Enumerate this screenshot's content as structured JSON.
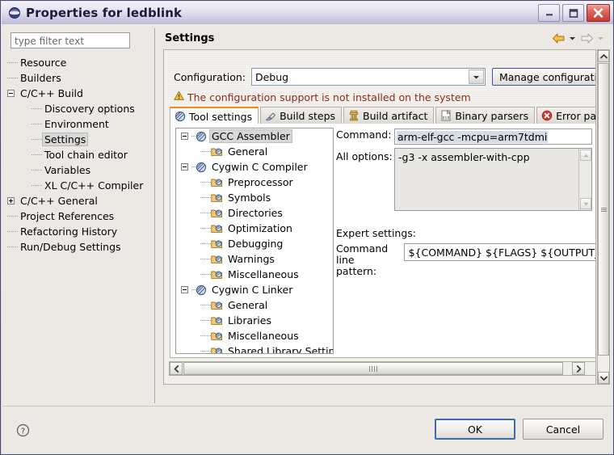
{
  "window": {
    "title": "Properties for ledblink",
    "icon": "eclipse-sphere-icon",
    "minimize_label": "Minimize",
    "maximize_label": "Maximize",
    "close_label": "Close"
  },
  "filter": {
    "placeholder": "type filter text",
    "value": ""
  },
  "nav_tree": [
    {
      "label": "Resource",
      "depth": 1,
      "expander": "none",
      "selected": false
    },
    {
      "label": "Builders",
      "depth": 1,
      "expander": "none",
      "selected": false
    },
    {
      "label": "C/C++ Build",
      "depth": 1,
      "expander": "collapse",
      "selected": false
    },
    {
      "label": "Discovery options",
      "depth": 2,
      "expander": "none",
      "selected": false
    },
    {
      "label": "Environment",
      "depth": 2,
      "expander": "none",
      "selected": false
    },
    {
      "label": "Settings",
      "depth": 2,
      "expander": "none",
      "selected": true
    },
    {
      "label": "Tool chain editor",
      "depth": 2,
      "expander": "none",
      "selected": false
    },
    {
      "label": "Variables",
      "depth": 2,
      "expander": "none",
      "selected": false
    },
    {
      "label": "XL C/C++ Compiler",
      "depth": 2,
      "expander": "none",
      "selected": false
    },
    {
      "label": "C/C++ General",
      "depth": 1,
      "expander": "expand",
      "selected": false
    },
    {
      "label": "Project References",
      "depth": 1,
      "expander": "none",
      "selected": false
    },
    {
      "label": "Refactoring History",
      "depth": 1,
      "expander": "none",
      "selected": false
    },
    {
      "label": "Run/Debug Settings",
      "depth": 1,
      "expander": "none",
      "selected": false
    }
  ],
  "page": {
    "title": "Settings",
    "back_icon": "back-arrow-icon",
    "back_dropdown_icon": "chevron-down-icon",
    "forward_icon": "forward-arrow-icon",
    "forward_dropdown_icon": "chevron-down-icon"
  },
  "configuration": {
    "label": "Configuration:",
    "value": "Debug",
    "dropdown_icon": "chevron-down-icon",
    "manage_button": "Manage configurations..."
  },
  "warning": {
    "icon": "warning-triangle-icon",
    "text": "The configuration support is not installed on the system",
    "color": "#8c2b17"
  },
  "tabs": [
    {
      "label": "Tool settings",
      "icon": "tool-settings-icon",
      "active": true
    },
    {
      "label": "Build steps",
      "icon": "build-steps-icon",
      "active": false
    },
    {
      "label": "Build artifact",
      "icon": "build-artifact-icon",
      "active": false
    },
    {
      "label": "Binary parsers",
      "icon": "binary-parsers-icon",
      "active": false
    },
    {
      "label": "Error parsers",
      "icon": "error-parsers-icon",
      "active": false
    }
  ],
  "tool_tree": [
    {
      "label": "GCC Assembler",
      "depth": 1,
      "expander": "collapse",
      "icon": "tool-icon",
      "selected": true
    },
    {
      "label": "General",
      "depth": 2,
      "expander": "none",
      "icon": "folder-icon",
      "selected": false
    },
    {
      "label": "Cygwin C Compiler",
      "depth": 1,
      "expander": "collapse",
      "icon": "tool-icon",
      "selected": false
    },
    {
      "label": "Preprocessor",
      "depth": 2,
      "expander": "none",
      "icon": "folder-icon",
      "selected": false
    },
    {
      "label": "Symbols",
      "depth": 2,
      "expander": "none",
      "icon": "folder-icon",
      "selected": false
    },
    {
      "label": "Directories",
      "depth": 2,
      "expander": "none",
      "icon": "folder-icon",
      "selected": false
    },
    {
      "label": "Optimization",
      "depth": 2,
      "expander": "none",
      "icon": "folder-icon",
      "selected": false
    },
    {
      "label": "Debugging",
      "depth": 2,
      "expander": "none",
      "icon": "folder-icon",
      "selected": false
    },
    {
      "label": "Warnings",
      "depth": 2,
      "expander": "none",
      "icon": "folder-icon",
      "selected": false
    },
    {
      "label": "Miscellaneous",
      "depth": 2,
      "expander": "none",
      "icon": "folder-icon",
      "selected": false
    },
    {
      "label": "Cygwin C Linker",
      "depth": 1,
      "expander": "collapse",
      "icon": "tool-icon",
      "selected": false
    },
    {
      "label": "General",
      "depth": 2,
      "expander": "none",
      "icon": "folder-icon",
      "selected": false
    },
    {
      "label": "Libraries",
      "depth": 2,
      "expander": "none",
      "icon": "folder-icon",
      "selected": false
    },
    {
      "label": "Miscellaneous",
      "depth": 2,
      "expander": "none",
      "icon": "folder-icon",
      "selected": false
    },
    {
      "label": "Shared Library Settings",
      "depth": 2,
      "expander": "none",
      "icon": "folder-icon",
      "selected": false
    }
  ],
  "form": {
    "command_label": "Command:",
    "command_value": "arm-elf-gcc -mcpu=arm7tdmi",
    "all_options_label": "All options:",
    "all_options_value": "-g3 -x assembler-with-cpp",
    "expert_label": "Expert settings:",
    "pattern_label_line1": "Command",
    "pattern_label_line2": "line pattern:",
    "pattern_value": "${COMMAND} ${FLAGS} ${OUTPUT_FLAG}"
  },
  "footer": {
    "help_icon": "help-question-icon",
    "ok_label": "OK",
    "cancel_label": "Cancel"
  }
}
